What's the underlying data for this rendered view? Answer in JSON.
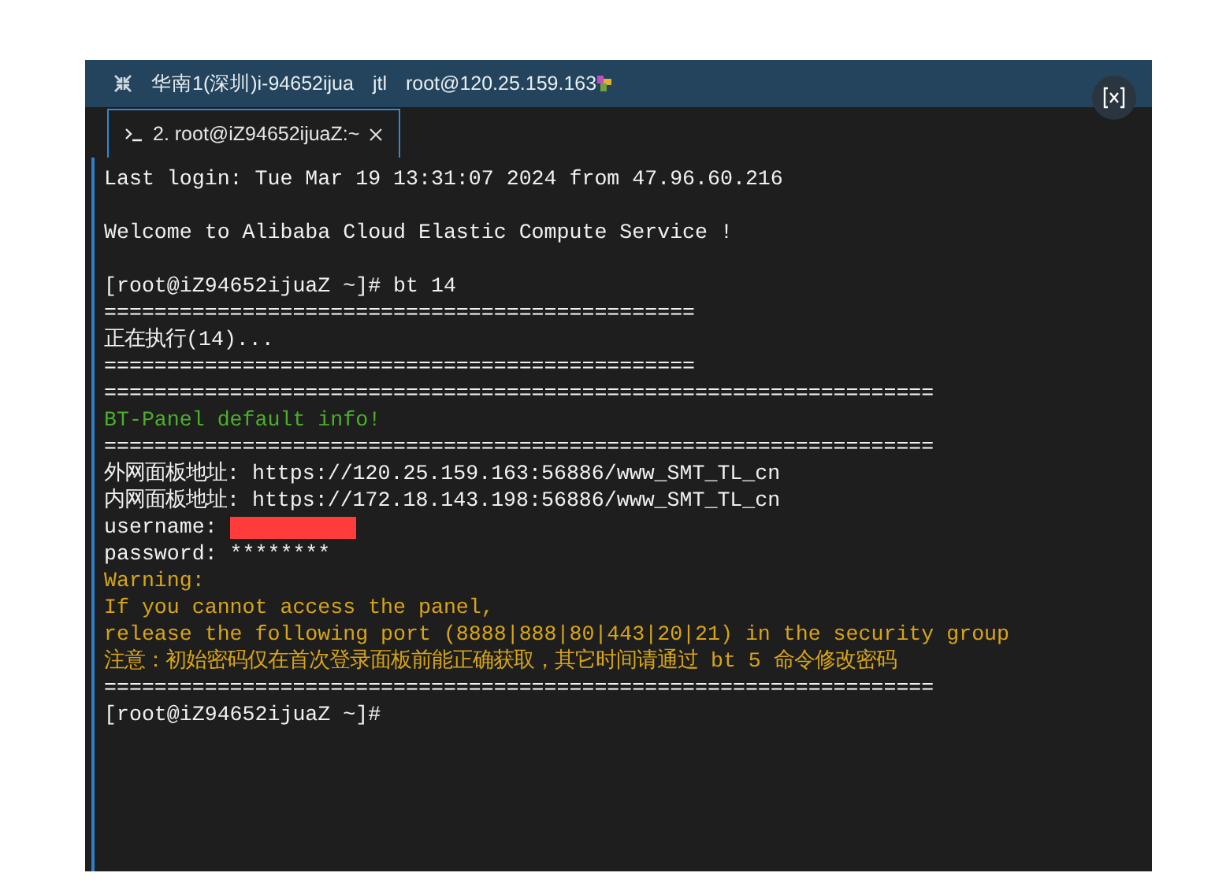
{
  "title_bar": {
    "items": [
      "华南1(深圳)i-94652ijua",
      "jtl",
      "root@120.25.159.163"
    ]
  },
  "tabs": [
    {
      "label": "2. root@iZ94652ijuaZ:~",
      "selected": true
    }
  ],
  "terminal": {
    "lines": [
      {
        "kind": "plain",
        "text": "Last login: Tue Mar 19 13:31:07 2024 from 47.96.60.216"
      },
      {
        "kind": "blank"
      },
      {
        "kind": "plain",
        "text": "Welcome to Alibaba Cloud Elastic Compute Service !"
      },
      {
        "kind": "blank"
      },
      {
        "kind": "plain",
        "text": "[root@iZ94652ijuaZ ~]# bt 14"
      },
      {
        "kind": "plain",
        "text": "==============================================="
      },
      {
        "kind": "plain",
        "text": "正在执行(14)..."
      },
      {
        "kind": "plain",
        "text": "==============================================="
      },
      {
        "kind": "plain",
        "text": "=================================================================="
      },
      {
        "kind": "green",
        "text": "BT-Panel default info!"
      },
      {
        "kind": "plain",
        "text": "=================================================================="
      },
      {
        "kind": "plain",
        "text": "外网面板地址: https://120.25.159.163:56886/www_SMT_TL_cn"
      },
      {
        "kind": "plain",
        "text": "内网面板地址: https://172.18.143.198:56886/www_SMT_TL_cn"
      },
      {
        "kind": "redacted",
        "text": "username: "
      },
      {
        "kind": "plain",
        "text": "password: ********"
      },
      {
        "kind": "yellow",
        "text": "Warning:"
      },
      {
        "kind": "yellow",
        "text": "If you cannot access the panel,"
      },
      {
        "kind": "yellow",
        "text": "release the following port (8888|888|80|443|20|21) in the security group"
      },
      {
        "kind": "yellow",
        "text": "注意：初始密码仅在首次登录面板前能正确获取，其它时间请通过 bt 5 命令修改密码"
      },
      {
        "kind": "plain",
        "text": "=================================================================="
      },
      {
        "kind": "plain",
        "text": "[root@iZ94652ijuaZ ~]#"
      }
    ]
  }
}
